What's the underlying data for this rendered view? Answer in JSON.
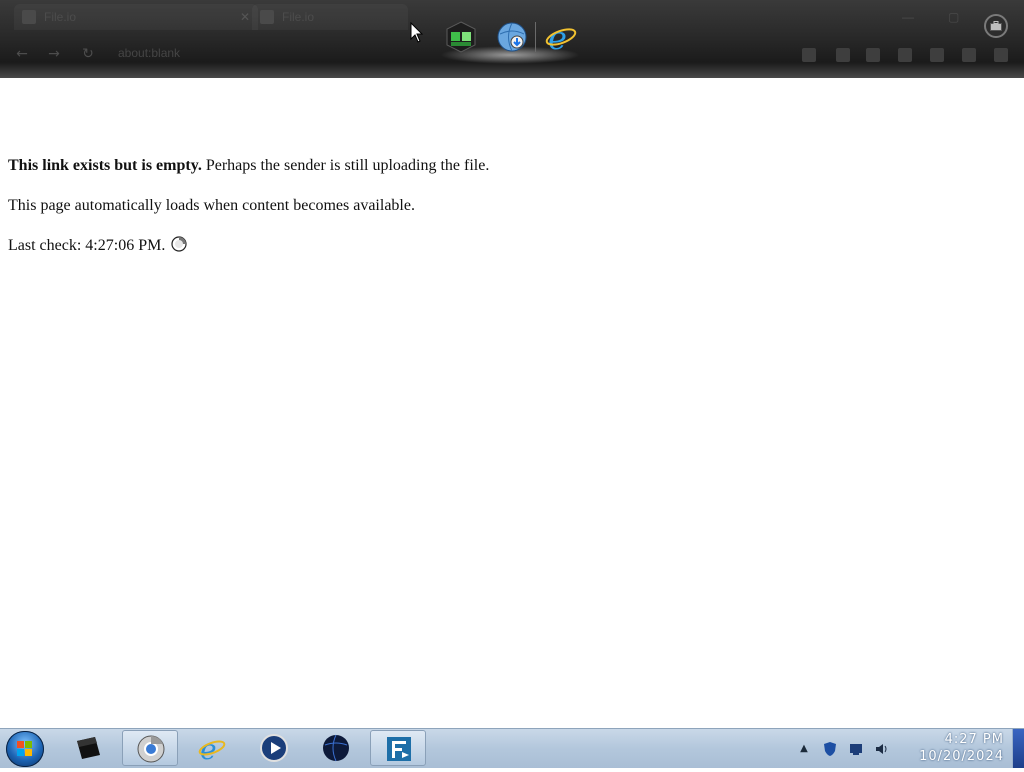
{
  "browser": {
    "tabs": [
      {
        "label": "File.io"
      },
      {
        "label": "File.io"
      }
    ],
    "address_hint": "about:blank",
    "window_buttons": {
      "minimize": "—",
      "maximize": "▢",
      "close": "✕"
    }
  },
  "dock": {
    "items": [
      {
        "icon": "toolbox-app-icon"
      },
      {
        "icon": "globe-download-icon"
      },
      {
        "icon": "internet-explorer-icon"
      }
    ]
  },
  "page": {
    "line1_bold": "This link exists but is empty.",
    "line1_rest": " Perhaps the sender is still uploading the file.",
    "line2": "This page automatically loads when content becomes available.",
    "line3": "Last check: 4:27:06 PM."
  },
  "taskbar": {
    "apps": [
      {
        "icon": "terminal-icon"
      },
      {
        "icon": "chrome-icon"
      },
      {
        "icon": "internet-explorer-icon"
      },
      {
        "icon": "media-player-icon"
      },
      {
        "icon": "globe-icon"
      },
      {
        "icon": "filezilla-icon"
      }
    ],
    "tray": {
      "arrow": "▲"
    },
    "clock": {
      "time": "4:27 PM",
      "date": "10/20/2024"
    }
  },
  "colors": {
    "chrome_bg": "#2a2a2a",
    "taskbar_bg": "#b3c7dc",
    "page_bg": "#ffffff",
    "text": "#111111"
  }
}
